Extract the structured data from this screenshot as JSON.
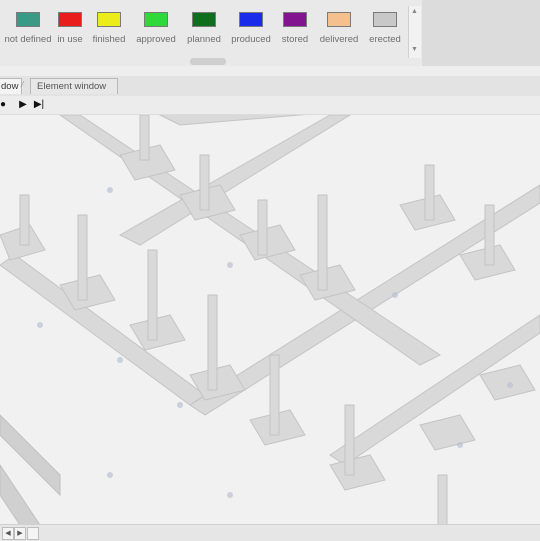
{
  "status_palette": {
    "items": [
      {
        "label": "not defined",
        "color": "#3a9a86"
      },
      {
        "label": "in use",
        "color": "#ea1d1d"
      },
      {
        "label": "finished",
        "color": "#ecec1b"
      },
      {
        "label": "approved",
        "color": "#2fd93a"
      },
      {
        "label": "planned",
        "color": "#0f6e1d"
      },
      {
        "label": "produced",
        "color": "#1a2bea"
      },
      {
        "label": "stored",
        "color": "#82158f"
      },
      {
        "label": "delivered",
        "color": "#f3c08e"
      },
      {
        "label": "erected",
        "color": "#c8c8c8"
      }
    ]
  },
  "tabs": {
    "model_label": "dow",
    "element_label": "Element window"
  },
  "playback": {
    "play_icon": "play-icon",
    "next_icon": "step-forward-icon"
  },
  "colors": {
    "viewport_bg": "#f1f1f1",
    "structure": "#d6d6d6"
  }
}
